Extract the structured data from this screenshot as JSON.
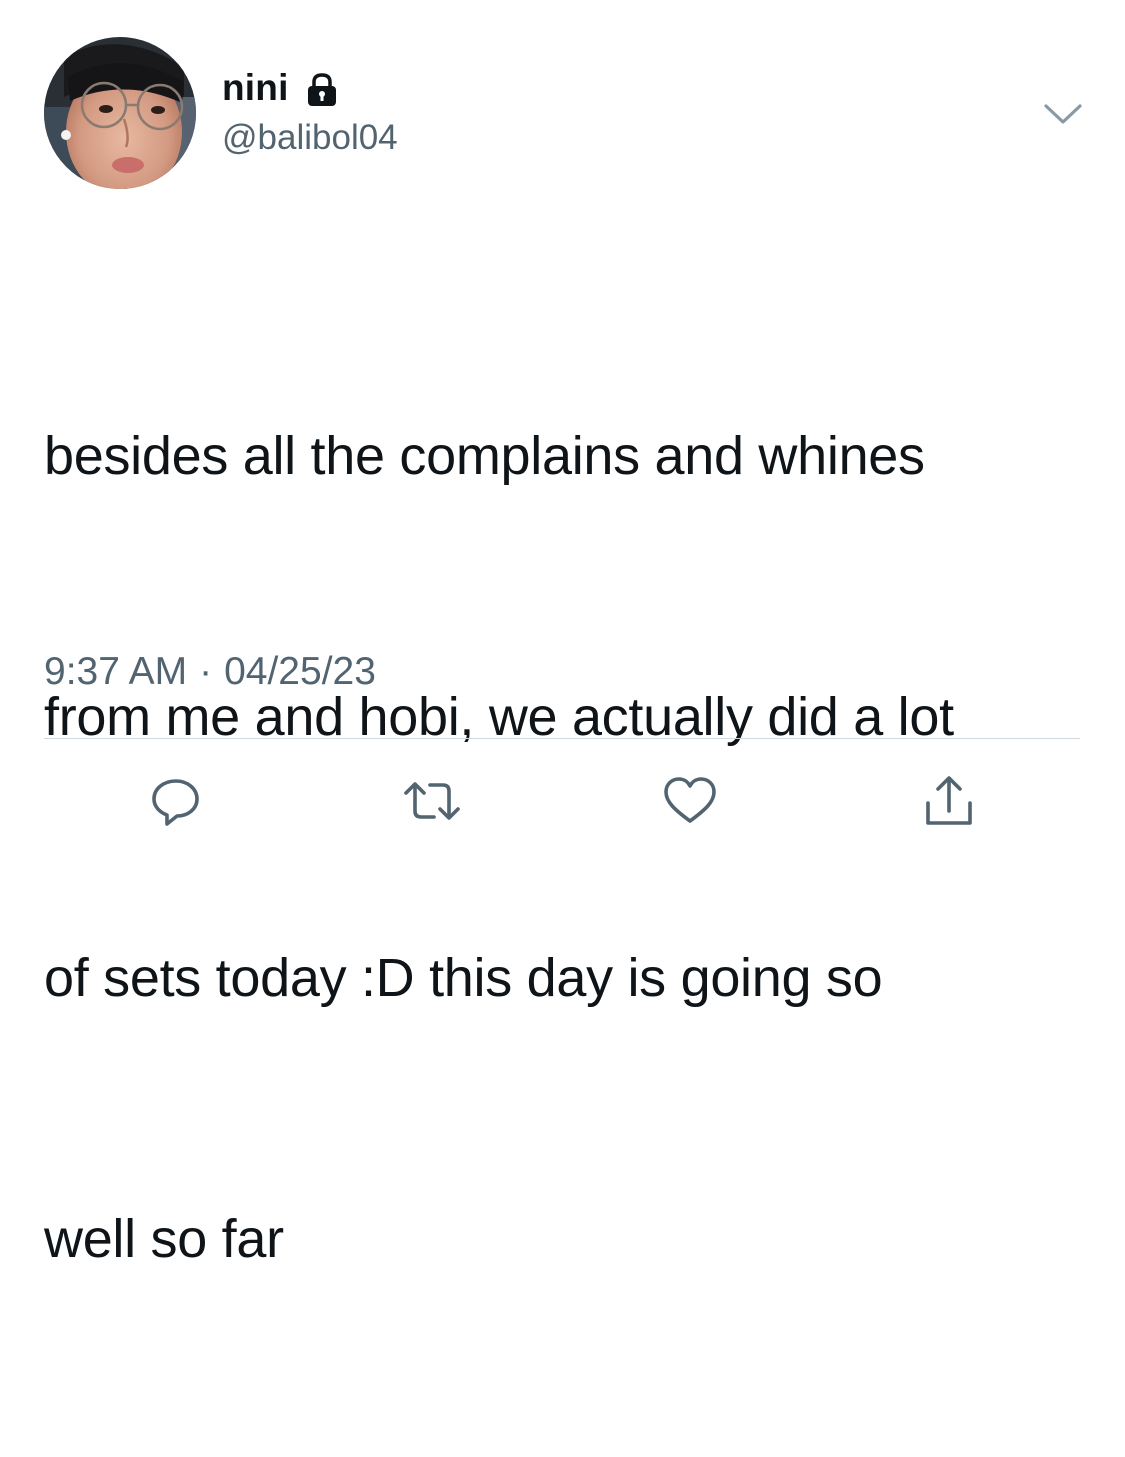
{
  "author": {
    "display_name": "nini",
    "handle": "@balibol04",
    "protected": true
  },
  "tweet": {
    "lines": [
      "besides all the complains and whines",
      "from me and hobi, we actually did a lot",
      "of sets today :D this day is going so",
      "well so far"
    ],
    "time": "9:37 AM",
    "separator": "·",
    "date": "04/25/23"
  },
  "icons": {
    "lock": "lock-icon",
    "caret": "chevron-down-icon",
    "reply": "reply-icon",
    "retweet": "retweet-icon",
    "like": "heart-icon",
    "share": "share-icon"
  },
  "colors": {
    "text": "#0f1419",
    "secondary": "#536471",
    "divider": "#cfd9de",
    "background": "#ffffff"
  }
}
